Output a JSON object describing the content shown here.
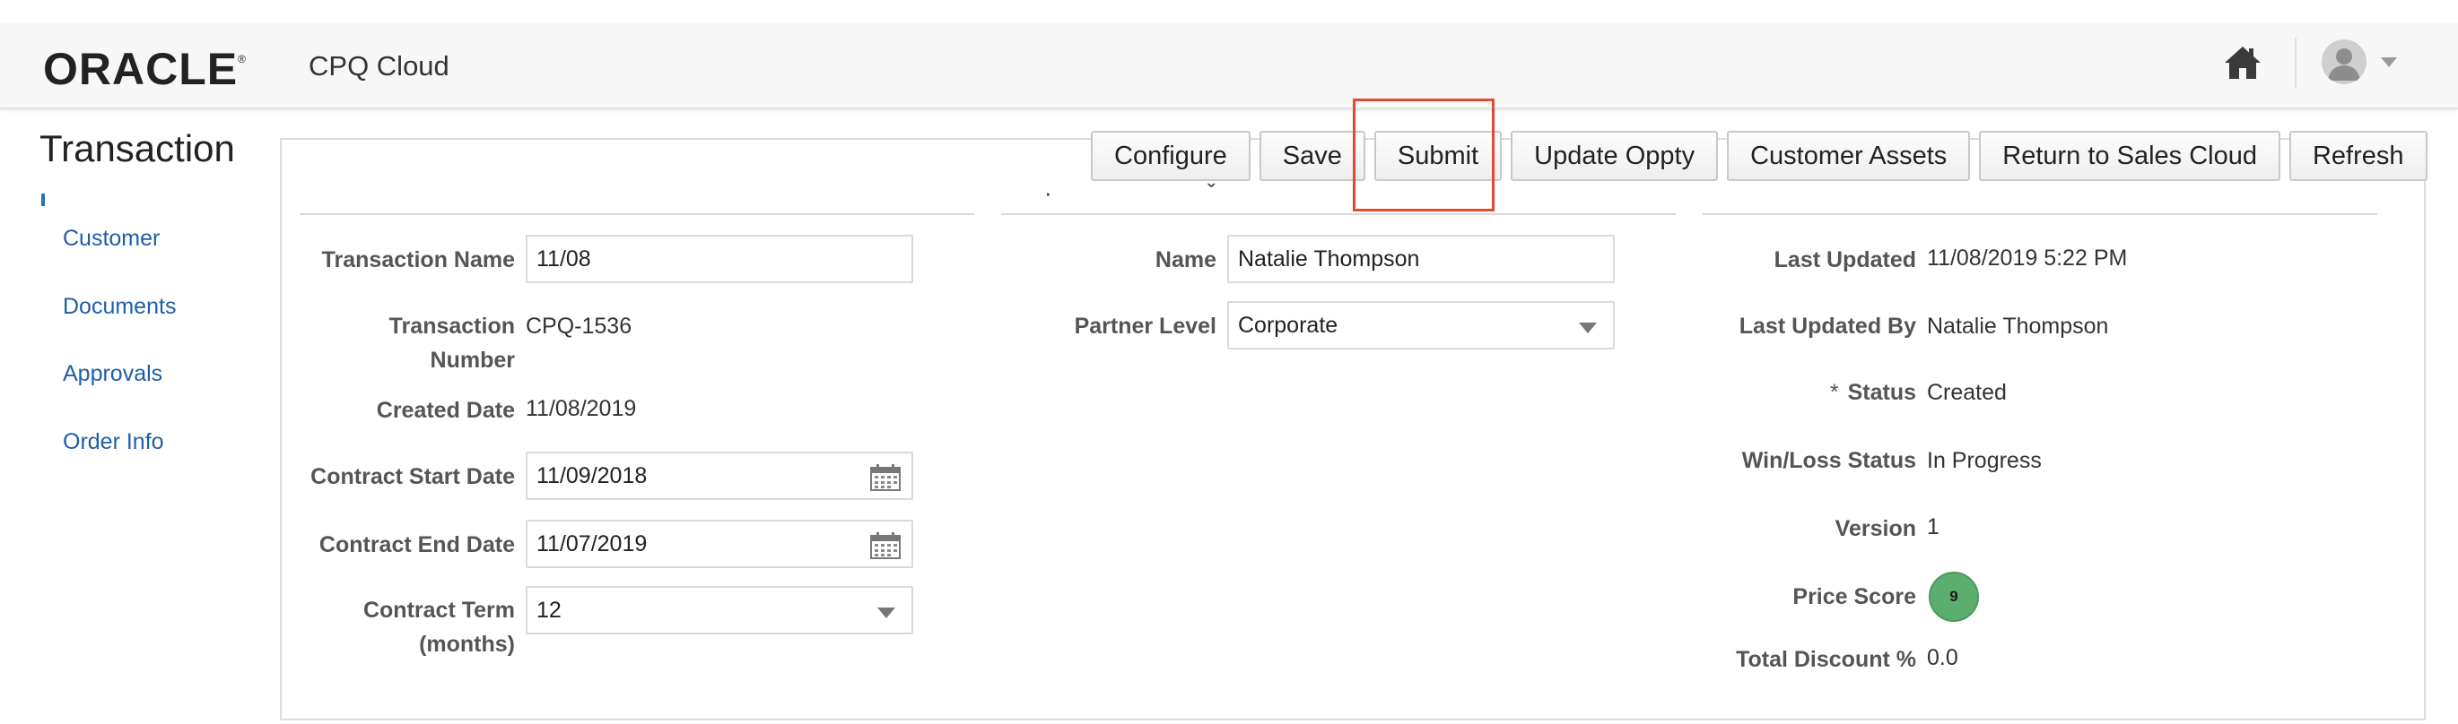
{
  "header": {
    "logo": "ORACLE",
    "logo_mark": "®",
    "product": "CPQ Cloud",
    "home_icon": "home-icon",
    "avatar_icon": "user-avatar-icon"
  },
  "page": {
    "title": "Transaction"
  },
  "actions": {
    "configure": "Configure",
    "save": "Save",
    "submit": "Submit",
    "update_oppty": "Update Oppty",
    "customer_assets": "Customer Assets",
    "return_to_sales_cloud": "Return to Sales Cloud",
    "refresh": "Refresh"
  },
  "highlight_color": "#e34b2f",
  "sidebar": {
    "items": [
      {
        "label": "Customer"
      },
      {
        "label": "Documents"
      },
      {
        "label": "Approvals"
      },
      {
        "label": "Order Info"
      }
    ]
  },
  "col1": {
    "transaction_name": {
      "label": "Transaction Name",
      "value": "11/08"
    },
    "transaction_number": {
      "label": "Transaction Number",
      "value": "CPQ-1536"
    },
    "created_date": {
      "label": "Created Date",
      "value": "11/08/2019"
    },
    "contract_start_date": {
      "label": "Contract Start Date",
      "value": "11/09/2018"
    },
    "contract_end_date": {
      "label": "Contract End Date",
      "value": "11/07/2019"
    },
    "contract_term": {
      "label": "Contract Term (months)",
      "value": "12"
    }
  },
  "col2": {
    "name": {
      "label": "Name",
      "value": "Natalie Thompson"
    },
    "partner_level": {
      "label": "Partner Level",
      "value": "Corporate"
    }
  },
  "col3": {
    "last_updated": {
      "label": "Last Updated",
      "value": "11/08/2019 5:22 PM"
    },
    "last_updated_by": {
      "label": "Last Updated By",
      "value": "Natalie Thompson"
    },
    "status": {
      "label": "Status",
      "required_mark": "*",
      "value": "Created"
    },
    "win_loss_status": {
      "label": "Win/Loss Status",
      "value": "In Progress"
    },
    "version": {
      "label": "Version",
      "value": "1"
    },
    "price_score": {
      "label": "Price Score",
      "value": "9",
      "color": "#5cae6e"
    },
    "total_discount": {
      "label": "Total Discount %",
      "value": "0.0"
    }
  }
}
